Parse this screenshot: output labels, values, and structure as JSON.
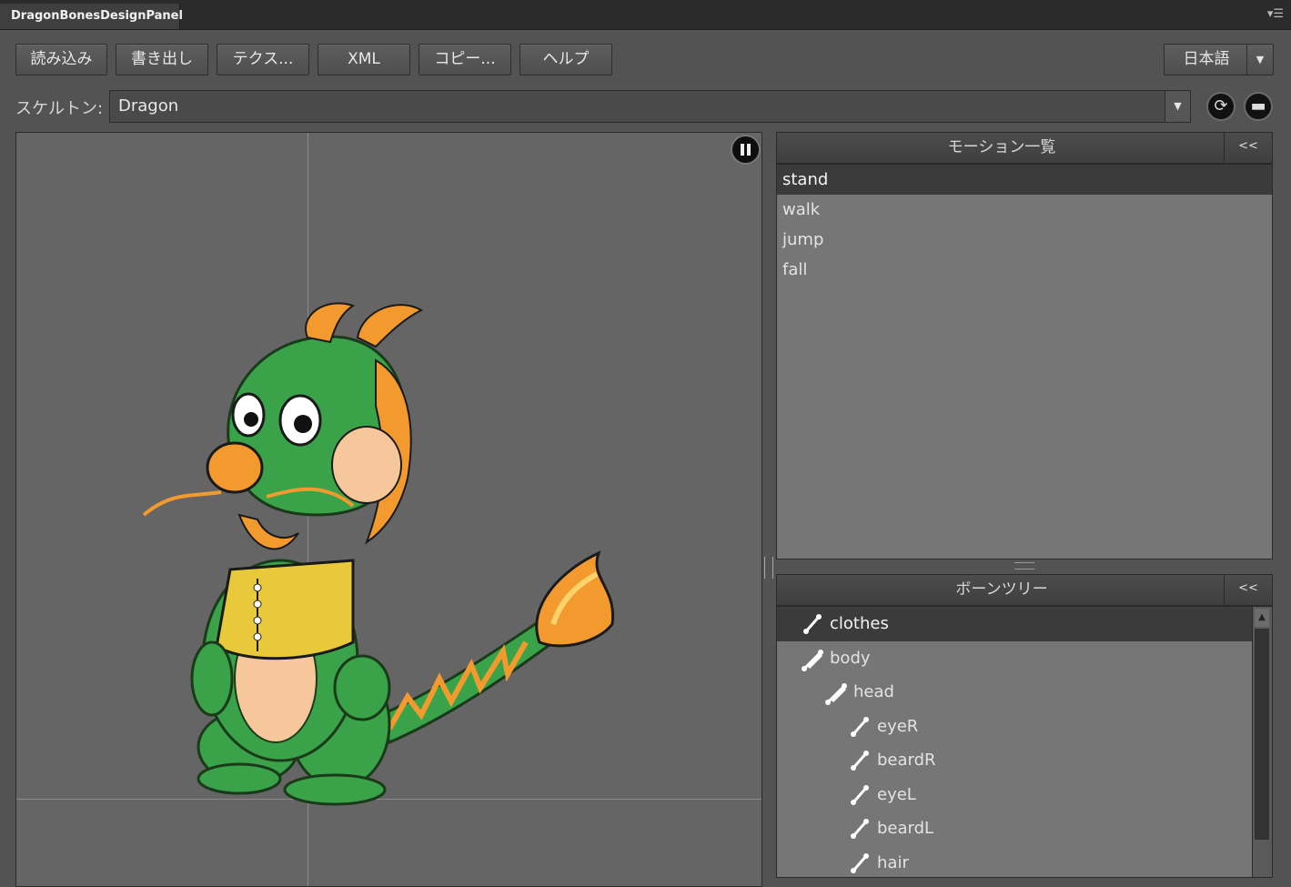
{
  "window": {
    "title": "DragonBonesDesignPanel",
    "menu_icon": "panel-menu-icon"
  },
  "toolbar": {
    "buttons": [
      "読み込み",
      "書き出し",
      "テクス...",
      "XML",
      "コピー...",
      "ヘルプ"
    ],
    "language": "日本語"
  },
  "skeleton": {
    "label": "スケルトン:",
    "value": "Dragon"
  },
  "motion_panel": {
    "title": "モーション一覧",
    "collapse_label": "<<",
    "items": [
      "stand",
      "walk",
      "jump",
      "fall"
    ],
    "selected": "stand"
  },
  "bone_panel": {
    "title": "ボーンツリー",
    "collapse_label": "<<",
    "items": [
      {
        "name": "clothes",
        "icon": "bone-icon"
      },
      {
        "name": "body",
        "icon": "bone-group-icon"
      },
      {
        "name": "head",
        "icon": "bone-group-icon"
      },
      {
        "name": "eyeR",
        "icon": "bone-icon"
      },
      {
        "name": "beardR",
        "icon": "bone-icon"
      },
      {
        "name": "eyeL",
        "icon": "bone-icon"
      },
      {
        "name": "beardL",
        "icon": "bone-icon"
      },
      {
        "name": "hair",
        "icon": "bone-icon"
      }
    ],
    "selected": "clothes"
  },
  "colors": {
    "dragon_green": "#3aa34a",
    "dragon_orange": "#f29a2e",
    "vest_yellow": "#e8c93a"
  }
}
